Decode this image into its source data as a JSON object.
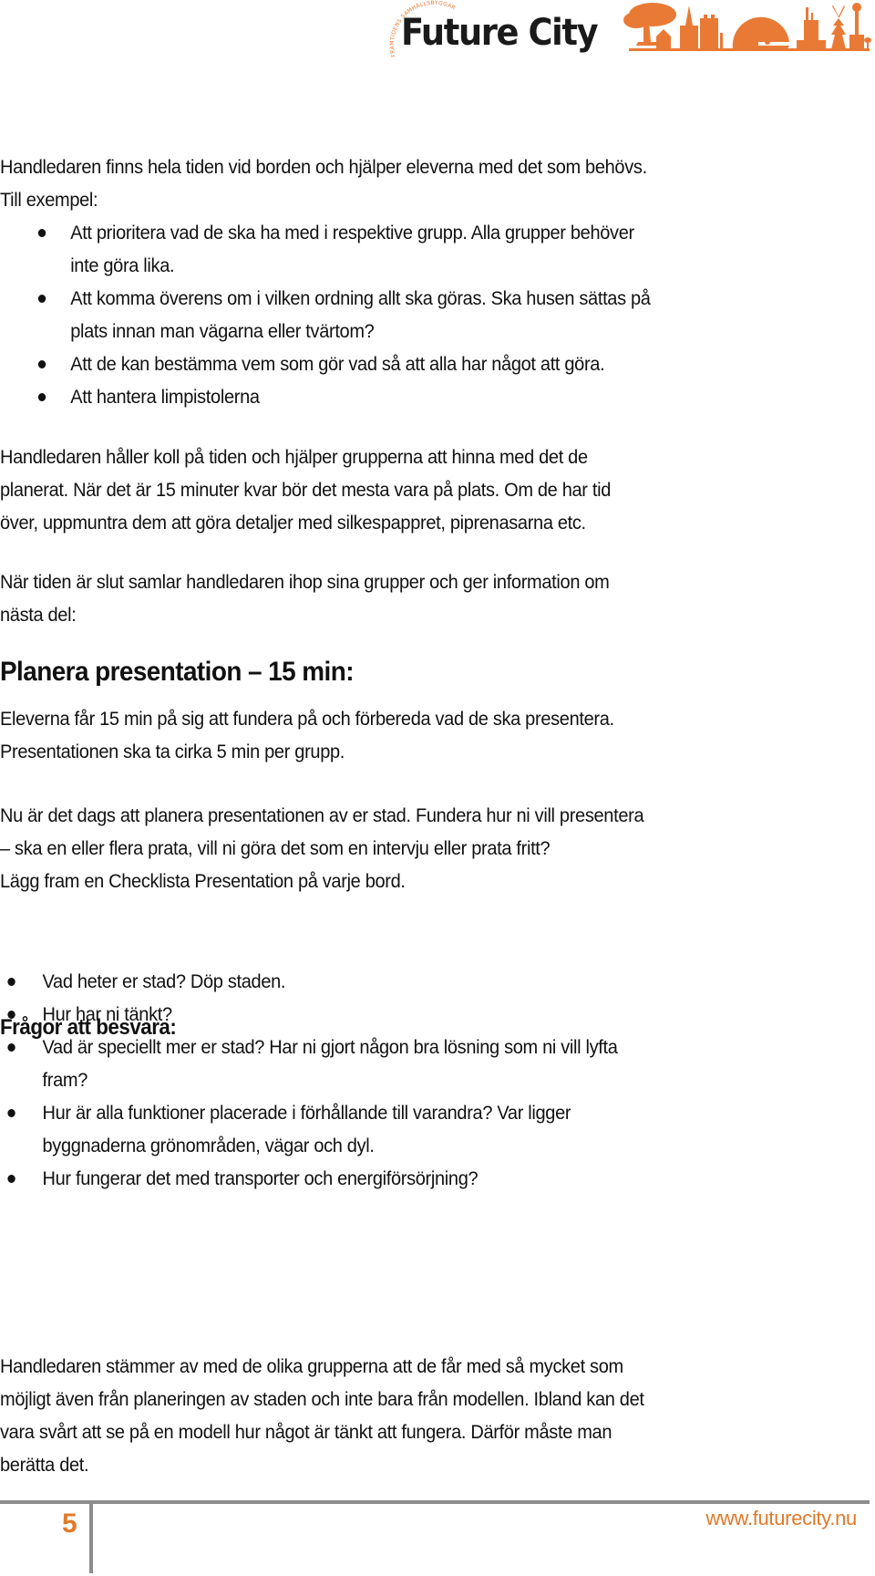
{
  "header": {
    "logo": {
      "wordmark": "Future City",
      "tagline": "FRAMTIDENS SAMHÄLLSBYGGARE",
      "icon": "city-skyline-icon",
      "brand_color": "#e97a35"
    }
  },
  "content": {
    "p1_lines": [
      "Handledaren finns hela tiden vid borden och hjälper eleverna med det som behövs.",
      "Till exempel:"
    ],
    "list1": [
      {
        "lines": [
          "Att prioritera vad de ska ha med i respektive grupp. Alla grupper behöver",
          "inte göra lika."
        ]
      },
      {
        "lines": [
          "Att komma överens om i vilken ordning allt ska göras. Ska husen sättas på",
          "plats innan man vägarna eller tvärtom?"
        ]
      },
      {
        "lines": [
          "Att de kan bestämma vem som gör vad så att alla har något att göra."
        ]
      },
      {
        "lines": [
          "Att hantera limpistolerna"
        ]
      }
    ],
    "p2_lines": [
      "Handledaren håller koll på tiden och hjälper grupperna att hinna med det de",
      "planerat. När det är 15 minuter kvar bör det mesta vara på plats. Om de har tid",
      "över, uppmuntra dem att göra detaljer med silkespappret, piprenasarna etc."
    ],
    "p3_lines": [
      "När tiden är slut samlar handledaren ihop sina grupper och ger information om",
      "nästa del:"
    ],
    "heading_presentation": "Planera presentation – 15 min:",
    "p4_lines": [
      "Eleverna får 15 min på sig att fundera på och förbereda vad de ska presentera.",
      "Presentationen ska ta cirka 5 min per grupp."
    ],
    "p5_lines": [
      "Nu är det dags att planera presentationen av er stad. Fundera hur ni vill presentera",
      "– ska en eller flera prata, vill ni göra det som en intervju eller prata fritt?",
      "Lägg fram en Checklista Presentation på varje bord."
    ],
    "heading_questions": "Frågor att besvara:",
    "list2": [
      {
        "lines": [
          "Vad heter er stad?  Döp staden."
        ]
      },
      {
        "lines": [
          "Hur har ni tänkt?"
        ]
      },
      {
        "lines": [
          "Vad är speciellt mer er stad? Har ni gjort någon bra lösning som ni vill lyfta",
          "fram?"
        ]
      },
      {
        "lines": [
          "Hur är alla funktioner placerade i förhållande till varandra? Var ligger",
          "byggnaderna grönområden, vägar och dyl."
        ]
      },
      {
        "lines": [
          "Hur fungerar det med transporter och energiförsörjning?"
        ]
      }
    ],
    "p6_lines": [
      "Handledaren stämmer av med de olika grupperna att de får med så mycket som",
      "möjligt även från planeringen av staden och inte bara från modellen. Ibland kan det",
      "vara svårt att se på en modell hur något är tänkt att fungera. Därför måste man",
      "berätta det."
    ]
  },
  "footer": {
    "page_number": "5",
    "url": "www.futurecity.nu",
    "accent_color": "#e07a2b",
    "rule_color": "#8c8c8c"
  }
}
